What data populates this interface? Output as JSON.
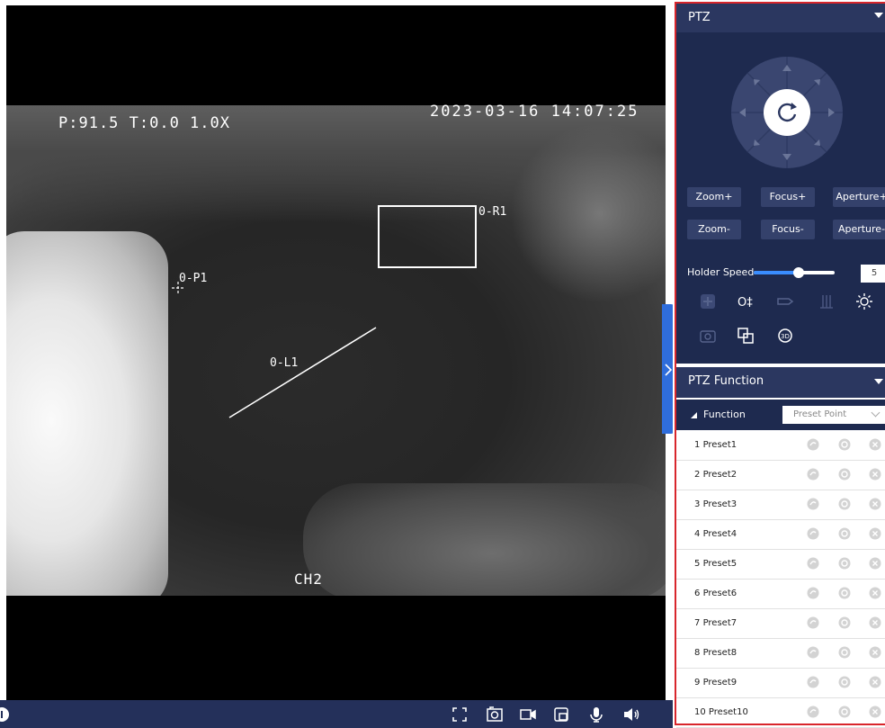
{
  "video": {
    "osd_ptz": "P:91.5 T:0.0 1.0X",
    "osd_time": "2023-03-16 14:07:25",
    "channel": "CH2",
    "roi_label": "0-R1",
    "point_label": "0-P1",
    "line_label": "0-L1"
  },
  "toolbar": {
    "icons": [
      "fullscreen-icon",
      "snapshot-icon",
      "record-icon",
      "window-icon",
      "microphone-icon",
      "volume-icon"
    ]
  },
  "ptz": {
    "title": "PTZ",
    "buttons": {
      "zoom_plus": "Zoom+",
      "focus_plus": "Focus+",
      "aperture_plus": "Aperture+",
      "zoom_minus": "Zoom-",
      "focus_minus": "Focus-",
      "aperture_minus": "Aperture-"
    },
    "holder_speed_label": "Holder Speed",
    "holder_speed_value": "5",
    "holder_speed_level": 0.55
  },
  "ptz_function": {
    "title": "PTZ Function",
    "function_label": "Function",
    "function_selected": "Preset Point",
    "presets": [
      {
        "num": "1",
        "name": "Preset1"
      },
      {
        "num": "2",
        "name": "Preset2"
      },
      {
        "num": "3",
        "name": "Preset3"
      },
      {
        "num": "4",
        "name": "Preset4"
      },
      {
        "num": "5",
        "name": "Preset5"
      },
      {
        "num": "6",
        "name": "Preset6"
      },
      {
        "num": "7",
        "name": "Preset7"
      },
      {
        "num": "8",
        "name": "Preset8"
      },
      {
        "num": "9",
        "name": "Preset9"
      },
      {
        "num": "10",
        "name": "Preset10"
      }
    ]
  },
  "colors": {
    "panel_bg": "#1e2a4f",
    "panel_header": "#2b3760",
    "highlight_border": "#d8262c",
    "accent": "#2f6ddb"
  }
}
